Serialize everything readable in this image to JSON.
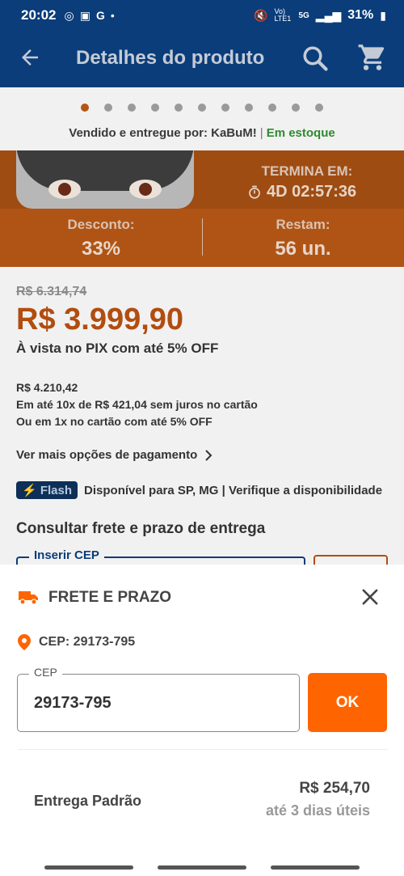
{
  "status": {
    "time": "20:02",
    "network": "5G",
    "volte": "Vo) LTE1",
    "battery": "31%"
  },
  "appbar": {
    "title": "Detalhes do produto"
  },
  "carousel": {
    "total_dots": 11,
    "active_index": 0
  },
  "seller": {
    "prefix": "Vendido e entregue por: KaBuM!",
    "separator": "|",
    "stock": "Em estoque"
  },
  "offer": {
    "ends_label": "TERMINA EM:",
    "countdown": "4D 02:57:36",
    "discount_label": "Desconto:",
    "discount_value": "33%",
    "remaining_label": "Restam:",
    "remaining_value": "56 un."
  },
  "pricing": {
    "old_price": "R$ 6.314,74",
    "price": "R$ 3.999,90",
    "pix_note": "À vista no PIX com até 5% OFF",
    "card_total": "R$ 4.210,42",
    "installments": "Em até 10x de R$ 421,04 sem juros no cartão",
    "one_time": "Ou em 1x no cartão com até 5% OFF",
    "more_options": "Ver mais opções de pagamento"
  },
  "flash": {
    "badge": "⚡ Flash",
    "text": "Disponível para SP, MG | Verifique a disponibilidade"
  },
  "shipping_section": {
    "title": "Consultar frete e prazo de entrega",
    "cep_label": "Inserir CEP"
  },
  "sheet": {
    "title": "FRETE E PRAZO",
    "cep_line": "CEP: 29173-795",
    "field_label": "CEP",
    "field_value": "29173-795",
    "ok_label": "OK",
    "option_name": "Entrega Padrão",
    "option_price": "R$ 254,70",
    "option_time": "até 3 dias úteis"
  },
  "colors": {
    "brand_blue": "#0a3d7a",
    "accent_orange": "#fe6500",
    "stock_green": "#2f8a2f"
  }
}
